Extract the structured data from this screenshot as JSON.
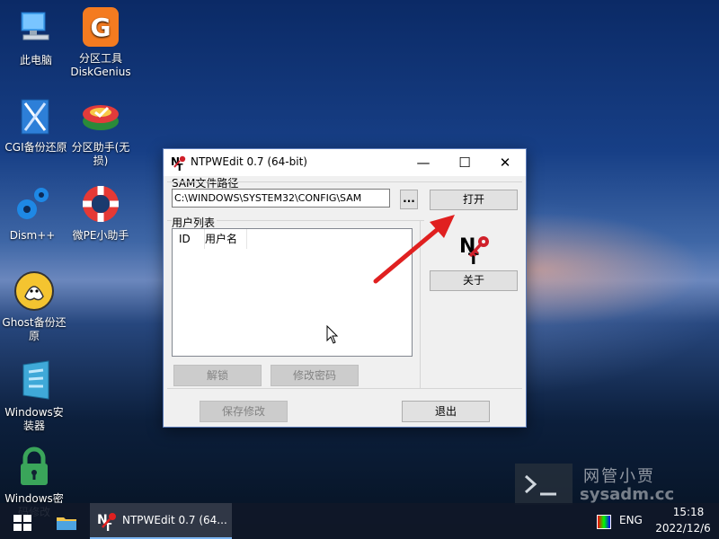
{
  "desktop": {
    "icons": [
      {
        "label": "此电脑",
        "icon": "computer-icon"
      },
      {
        "label": "分区工具\nDiskGenius",
        "icon": "diskgenius-icon"
      },
      {
        "label": "CGI备份还原",
        "icon": "cgi-backup-icon"
      },
      {
        "label": "分区助手(无\n损)",
        "icon": "partition-assistant-icon"
      },
      {
        "label": "Dism++",
        "icon": "gears-icon"
      },
      {
        "label": "微PE小助手",
        "icon": "lifebuoy-icon"
      },
      {
        "label": "Ghost备份还\n原",
        "icon": "ghost-icon"
      },
      {
        "label": "Windows安\n装器",
        "icon": "windows-installer-icon"
      },
      {
        "label": "Windows密\n码修改",
        "icon": "lock-icon"
      }
    ]
  },
  "window": {
    "title": "NTPWEdit 0.7 (64-bit)",
    "minimize": "—",
    "maximize": "☐",
    "close": "✕",
    "sam_label": "SAM文件路径",
    "sam_path": "C:\\WINDOWS\\SYSTEM32\\CONFIG\\SAM",
    "browse": "...",
    "open": "打开",
    "user_list_label": "用户列表",
    "columns": [
      "ID",
      "用户名"
    ],
    "about": "关于",
    "unlock": "解锁",
    "change_password": "修改密码",
    "save": "保存修改",
    "exit": "退出"
  },
  "watermark": {
    "line1": "网管小贾",
    "line2": "sysadm.cc"
  },
  "taskbar": {
    "app_label": "NTPWEdit 0.7 (64...",
    "lang": "ENG",
    "time": "15:18",
    "date": "2022/12/6"
  }
}
